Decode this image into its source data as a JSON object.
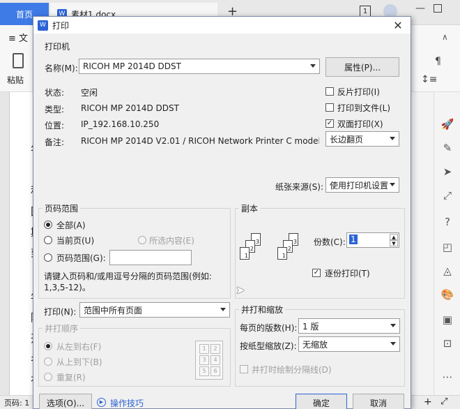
{
  "app": {
    "home_tab": "首页",
    "doc_tab": "素材1.docx",
    "doc_tab_icon": "W",
    "tab_count": "1",
    "menu_label": "≡ 文",
    "paste_label": "粘贴",
    "status_text": "页码: 1",
    "doc_chars": [
      "年",
      "和",
      "国",
      "斯",
      "到",
      "（",
      "年",
      "随",
      "开",
      "名",
      "有"
    ]
  },
  "dialog": {
    "title": "打印",
    "title_icon": "W",
    "printer": {
      "group_label": "打印机",
      "name_label": "名称(M):",
      "name_value": "RICOH MP 2014D DDST",
      "properties_button": "属性(P)...",
      "status_label": "状态:",
      "status_value": "空闲",
      "type_label": "类型:",
      "type_value": "RICOH MP 2014D DDST",
      "location_label": "位置:",
      "location_value": "IP_192.168.10.250",
      "comment_label": "备注:",
      "comment_value": "RICOH MP 2014D V2.01 / RICOH Network Printer C model /",
      "reverse_print": {
        "label": "反片打印(I)",
        "checked": false
      },
      "print_to_file": {
        "label": "打印到文件(L)",
        "checked": false
      },
      "duplex": {
        "label": "双面打印(X)",
        "checked": true
      },
      "duplex_mode": "长边翻页",
      "paper_source_label": "纸张来源(S):",
      "paper_source_value": "使用打印机设置"
    },
    "page_range": {
      "group_label": "页码范围",
      "all": "全部(A)",
      "current": "当前页(U)",
      "selection": "所选内容(E)",
      "range": "页码范围(G):",
      "range_value": "",
      "hint": "请键入页码和/或用逗号分隔的页码范围(例如: 1,3,5-12)。"
    },
    "print_what": {
      "label": "打印(N):",
      "value": "范围中所有页面"
    },
    "order": {
      "group_label": "并打顺序",
      "left_to_right": "从左到右(F)",
      "top_to_bottom": "从上到下(B)",
      "repeat": "重复(R)",
      "grid_numbers": [
        "1",
        "2",
        "3",
        "4",
        "5",
        "6"
      ]
    },
    "copies": {
      "group_label": "副本",
      "count_label": "份数(C):",
      "count_value": "1",
      "collate": {
        "label": "逐份打印(T)",
        "checked": true
      },
      "sheet_numbers": [
        "1",
        "2",
        "3"
      ]
    },
    "zoom": {
      "group_label": "并打和缩放",
      "pages_per_sheet_label": "每页的版数(H):",
      "pages_per_sheet_value": "1 版",
      "scale_label": "按纸型缩放(Z):",
      "scale_value": "无缩放",
      "separator_line": "并打时绘制分隔线(D)"
    },
    "options_button": "选项(O)...",
    "tips_link": "操作技巧",
    "ok_button": "确定",
    "cancel_button": "取消"
  }
}
